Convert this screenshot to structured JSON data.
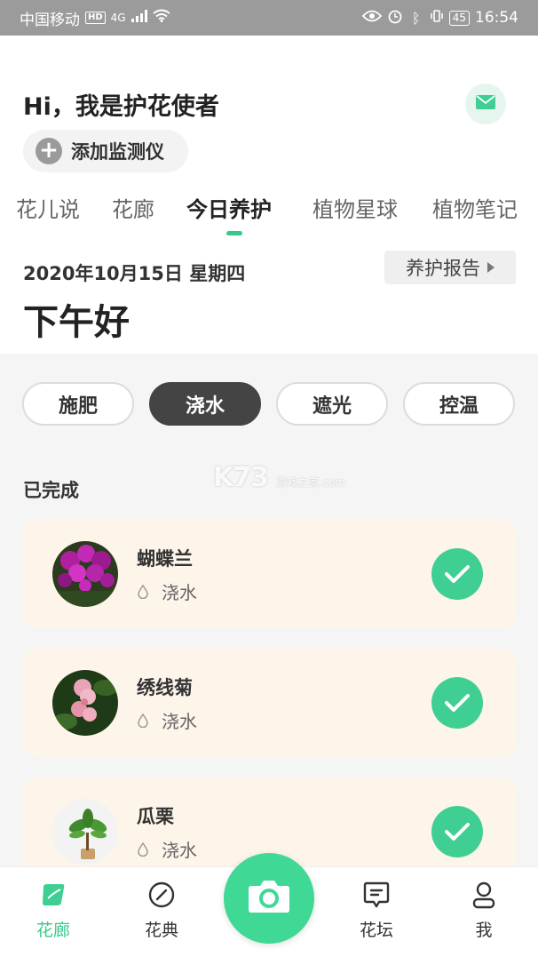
{
  "status_bar": {
    "carrier": "中国移动",
    "hd_badge": "HD",
    "network": "4G",
    "battery": "45",
    "time": "16:54"
  },
  "header": {
    "greeting": "Hi，我是护花使者",
    "add_device_label": "添加监测仪",
    "mail_icon": "mail-icon"
  },
  "tabs": [
    {
      "label": "花儿说",
      "active": false
    },
    {
      "label": "花廊",
      "active": false
    },
    {
      "label": "今日养护",
      "active": true
    },
    {
      "label": "植物星球",
      "active": false
    },
    {
      "label": "植物笔记",
      "active": false
    }
  ],
  "today": {
    "date": "2020年10月15日 星期四",
    "report_button": "养护报告",
    "salutation": "下午好"
  },
  "filters": [
    {
      "label": "施肥",
      "active": false
    },
    {
      "label": "浇水",
      "active": true
    },
    {
      "label": "遮光",
      "active": false
    },
    {
      "label": "控温",
      "active": false
    }
  ],
  "completed": {
    "title": "已完成",
    "items": [
      {
        "name": "蝴蝶兰",
        "task": "浇水",
        "done": true
      },
      {
        "name": "绣线菊",
        "task": "浇水",
        "done": true
      },
      {
        "name": "瓜栗",
        "task": "浇水",
        "done": true
      }
    ]
  },
  "watermark": {
    "brand": "K73",
    "sub": "游戏之家",
    "domain": ".com"
  },
  "bottom_nav": [
    {
      "label": "花廊",
      "icon": "leaf-icon",
      "active": true
    },
    {
      "label": "花典",
      "icon": "compass-icon",
      "active": false
    },
    {
      "label": "花坛",
      "icon": "message-icon",
      "active": false
    },
    {
      "label": "我",
      "icon": "user-icon",
      "active": false
    }
  ],
  "colors": {
    "accent": "#36c98a",
    "check_green": "#3fcf92",
    "card_bg": "#fdf4ea",
    "active_pill": "#444444"
  }
}
